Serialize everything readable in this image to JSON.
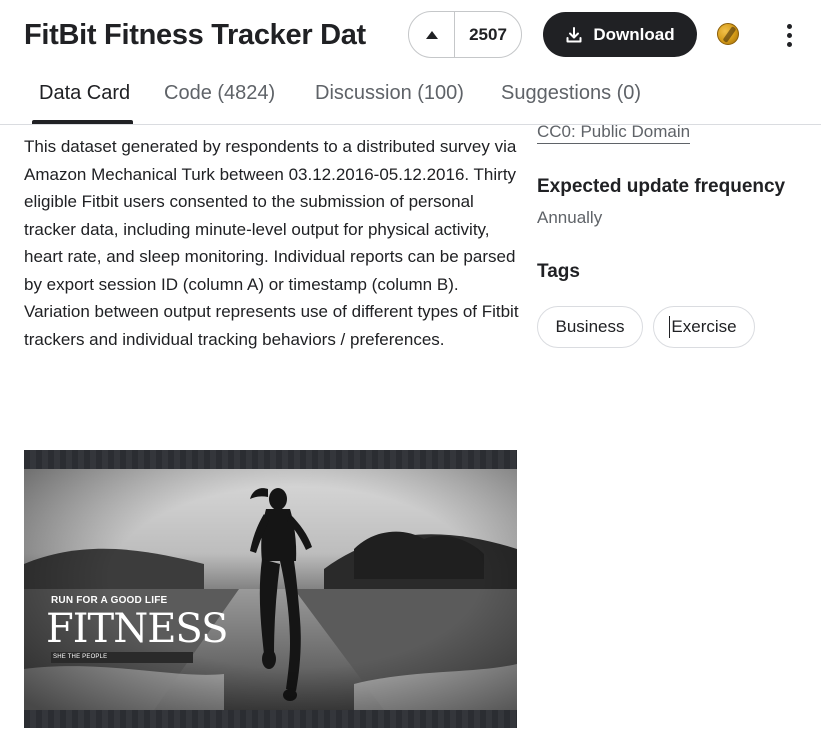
{
  "header": {
    "title": "FitBit Fitness Tracker Dat",
    "vote_count": "2507",
    "download_label": "Download",
    "medal": "gold-medal-icon"
  },
  "tabs": [
    {
      "label": "Data Card",
      "active": true
    },
    {
      "label": "Code (4824)",
      "active": false
    },
    {
      "label": "Discussion (100)",
      "active": false
    },
    {
      "label": "Suggestions (0)",
      "active": false
    }
  ],
  "description": "This dataset generated by respondents to a distributed survey via Amazon Mechanical Turk between 03.12.2016-05.12.2016. Thirty eligible Fitbit users consented to the submission of personal tracker data, including minute-level output for physical activity, heart rate, and sleep monitoring. Individual reports can be parsed by export session ID (column A) or timestamp (column B). Variation between output represents use of different types of Fitbit trackers and individual tracking behaviors / preferences.",
  "sidebar": {
    "license": "CC0: Public Domain",
    "update_frequency_heading": "Expected update frequency",
    "update_frequency_value": "Annually",
    "tags_heading": "Tags",
    "tags": [
      "Business",
      "Exercise"
    ]
  },
  "cover": {
    "tagline": "RUN FOR A GOOD LIFE",
    "headline": "FITNESS",
    "subline": "SHE THE PEOPLE"
  },
  "colors": {
    "primary_button": "#202124",
    "text": "#202124",
    "muted_text": "#5f6368",
    "border": "#dadce0"
  }
}
